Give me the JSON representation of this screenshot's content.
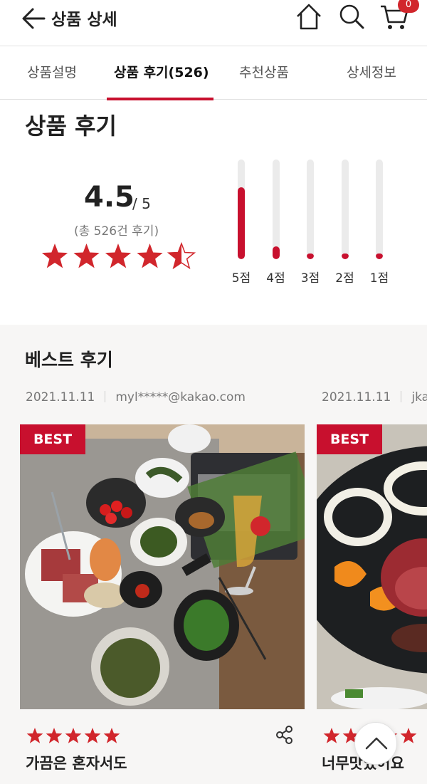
{
  "header": {
    "title": "상품 상세",
    "cart_count": "0",
    "icons": [
      "back-arrow-icon",
      "home-icon",
      "search-icon",
      "cart-icon"
    ]
  },
  "tabs": [
    {
      "label": "상품설명"
    },
    {
      "label": "상품 후기(526)",
      "active": true
    },
    {
      "label": "추천상품"
    },
    {
      "label": "상세정보"
    }
  ],
  "summary": {
    "title": "상품 후기",
    "score": "4.5",
    "score_max": "/ 5",
    "count_text": "(총 526건 후기)",
    "stars": 4.5,
    "distribution": [
      {
        "label": "5점",
        "ratio": 0.72
      },
      {
        "label": "4점",
        "ratio": 0.13
      },
      {
        "label": "3점",
        "ratio": 0.05
      },
      {
        "label": "2점",
        "ratio": 0.01
      },
      {
        "label": "1점",
        "ratio": 0.05
      }
    ]
  },
  "best": {
    "title": "베스트 후기",
    "tag": "BEST",
    "reviews": [
      {
        "date": "2021.11.11",
        "user": "myl*****@kakao.com",
        "stars": 5,
        "title": "가끔은 혼자서도"
      },
      {
        "date": "2021.11.11",
        "user": "jka",
        "stars": 5,
        "title": "너무맛있어요"
      }
    ]
  },
  "colors": {
    "accent": "#c8102e",
    "star": "#d1262c",
    "gray_bg": "#f7f6f5"
  }
}
